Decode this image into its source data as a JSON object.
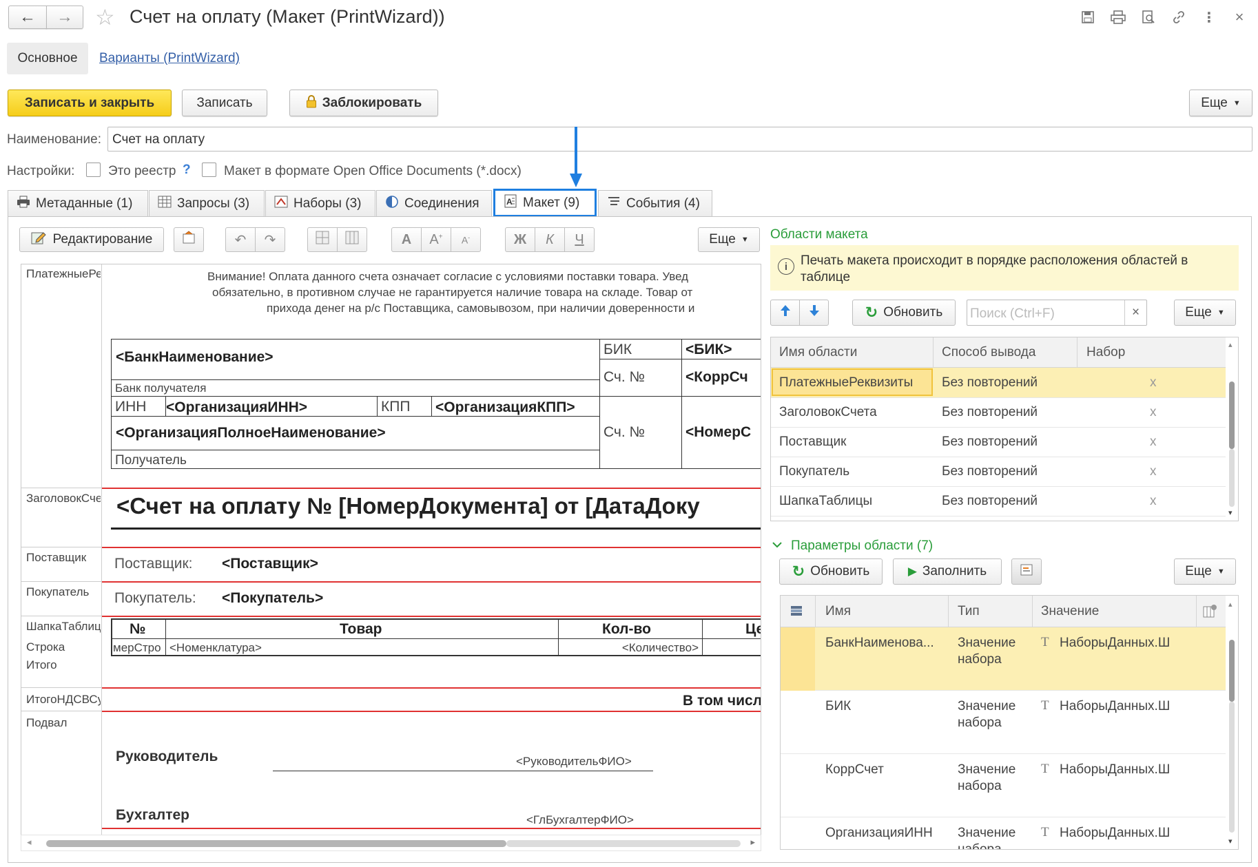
{
  "window": {
    "title": "Счет на оплату (Макет (PrintWizard))",
    "nav_back": "←",
    "nav_forward": "→"
  },
  "nav_tabs": {
    "main": "Основное",
    "variants": "Варианты (PrintWizard)"
  },
  "toolbar": {
    "save_close": "Записать и закрыть",
    "save": "Записать",
    "lock": "Заблокировать",
    "more": "Еще"
  },
  "form": {
    "name_label": "Наименование:",
    "name_value": "Счет на оплату",
    "settings_label": "Настройки:",
    "registry_label": "Это реестр",
    "help": "?",
    "docx_label": "Макет в формате Open Office Documents (*.docx)"
  },
  "tabs": [
    {
      "label": "Метаданные (1)"
    },
    {
      "label": "Запросы (3)"
    },
    {
      "label": "Наборы (3)"
    },
    {
      "label": "Соединения"
    },
    {
      "label": "Макет (9)"
    },
    {
      "label": "События (4)"
    }
  ],
  "editor_toolbar": {
    "edit": "Редактирование",
    "bold": "Ж",
    "italic": "К",
    "underline": "Ч",
    "font_a": "A",
    "more": "Еще"
  },
  "sheet": {
    "areas": [
      "ПлатежныеРеквизиты",
      "ЗаголовокСчета",
      "Поставщик",
      "Покупатель",
      "ШапкаТаблицы",
      "Строка",
      "Итого",
      "ИтогоНДСВСумме",
      "Подвал"
    ],
    "notice_lines": [
      "Внимание! Оплата данного счета означает согласие с условиями поставки товара. Увед",
      "обязательно, в противном случае не гарантируется наличие товара на складе. Товар от",
      "прихода денег на р/с Поставщика, самовывозом, при наличии доверенности и"
    ],
    "bank_name": "<БанкНаименование>",
    "bank_caption": "Банк получателя",
    "bik_label": "БИК",
    "bik_value": "<БИК>",
    "acc_label": "Сч. №",
    "corr_value": "<КоррСч",
    "inn_label": "ИНН",
    "inn_value": "<ОрганизацияИНН>",
    "kpp_label": "КПП",
    "kpp_value": "<ОрганизацияКПП>",
    "org_full": "<ОрганизацияПолноеНаименование>",
    "acc_label2": "Сч. №",
    "acc_value": "<НомерС",
    "recipient": "Получатель",
    "invoice_title": "<Счет на оплату № [НомерДокумента] от [ДатаДоку",
    "supplier_label": "Поставщик:",
    "supplier_value": "<Поставщик>",
    "buyer_label": "Покупатель:",
    "buyer_value": "<Покупатель>",
    "col_num": "№",
    "col_goods": "Товар",
    "col_qty": "Кол-во",
    "col_price": "Це",
    "row_num": "мерСтро",
    "row_goods": "<Номенклатура>",
    "row_qty": "<Количество>",
    "vat_text": "В том числ",
    "director": "Руководитель",
    "director_fio": "<РуководительФИО>",
    "accountant": "Бухгалтер",
    "accountant_fio": "<ГлБухгалтерФИО>"
  },
  "areas_panel": {
    "title": "Области макета",
    "info": "Печать макета происходит в порядке расположения областей в таблице",
    "refresh": "Обновить",
    "search_placeholder": "Поиск (Ctrl+F)",
    "more": "Еще",
    "columns": [
      "Имя области",
      "Способ вывода",
      "Набор"
    ],
    "rows": [
      {
        "name": "ПлатежныеРеквизиты",
        "mode": "Без повторений",
        "set": "x"
      },
      {
        "name": "ЗаголовокСчета",
        "mode": "Без повторений",
        "set": "x"
      },
      {
        "name": "Поставщик",
        "mode": "Без повторений",
        "set": "x"
      },
      {
        "name": "Покупатель",
        "mode": "Без повторений",
        "set": "x"
      },
      {
        "name": "ШапкаТаблицы",
        "mode": "Без повторений",
        "set": "x"
      }
    ]
  },
  "params_panel": {
    "title": "Параметры области (7)",
    "refresh": "Обновить",
    "fill": "Заполнить",
    "more": "Еще",
    "columns": [
      "Имя",
      "Тип",
      "Значение"
    ],
    "rows": [
      {
        "name": "БанкНаименова...",
        "type1": "Значение",
        "type2": "набора",
        "value": "НаборыДанных.Ш"
      },
      {
        "name": "БИК",
        "type1": "Значение",
        "type2": "набора",
        "value": "НаборыДанных.Ш"
      },
      {
        "name": "КоррСчет",
        "type1": "Значение",
        "type2": "набора",
        "value": "НаборыДанных.Ш"
      },
      {
        "name": "ОрганизацияИНН",
        "type1": "Значение",
        "type2": "набора",
        "value": "НаборыДанных.Ш"
      }
    ]
  },
  "colors": {
    "accent": "#1f7fe0",
    "primary_button": "#f5cd1a",
    "selection": "#fcefb4",
    "area_border": "#e03131",
    "group_title": "#2a9d3a"
  }
}
